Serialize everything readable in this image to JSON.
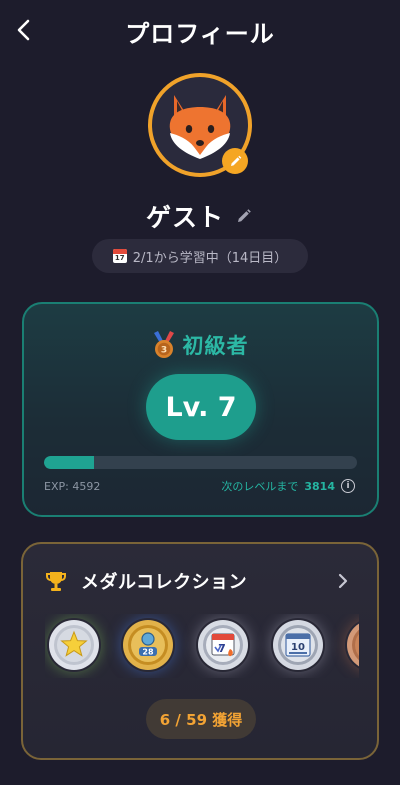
{
  "header": {
    "title": "プロフィール"
  },
  "profile": {
    "name": "ゲスト",
    "avatar": "fox-avatar",
    "study_period": "2/1から学習中（14日目）",
    "calendar_icon_number": "17"
  },
  "level": {
    "rank_label": "初級者",
    "rank_medal_number": "3",
    "level_label": "Lv. 7",
    "exp_text": "EXP: 4592",
    "next_label": "次のレベルまで",
    "next_value": "3814",
    "progress_fraction": 0.16
  },
  "medals": {
    "title": "メダルコレクション",
    "items": [
      {
        "icon": "star-medal",
        "label": ""
      },
      {
        "icon": "streak-medal",
        "label": "28"
      },
      {
        "icon": "calendar-7-medal",
        "label": "7"
      },
      {
        "icon": "book-10-medal",
        "label": "10"
      },
      {
        "icon": "bronze-medal",
        "label": ""
      }
    ],
    "count_text": "6 / 59 獲得"
  },
  "colors": {
    "background": "#1d1c2c",
    "accent_teal": "#1e9e8d",
    "accent_orange": "#f5a623",
    "gold_border": "#7a6438"
  }
}
